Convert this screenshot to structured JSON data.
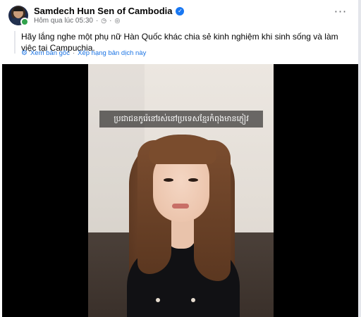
{
  "post": {
    "author_name": "Samdech Hun Sen of Cambodia",
    "timestamp": "Hôm qua lúc 05:30",
    "meta_separator": "·",
    "text": "Hãy lắng nghe một phụ nữ Hàn Quốc khác chia sẻ kinh nghiệm khi sinh sống và làm việc tại Campuchia.",
    "see_original_label": "Xem bản gốc",
    "translate_separator": "·",
    "rate_translation_label": "Xếp hạng bản dịch này"
  },
  "video": {
    "subtitle": "ប្រជាជនកូរ៉េនៅរស់នៅប្រទេសខ្មែរកំពុងមានភ្ញៀវ"
  },
  "icons": {
    "verified": "verified-badge-icon",
    "clock": "clock-icon",
    "globe": "globe-icon",
    "gear": "gear-icon",
    "more": "more-options-icon"
  },
  "colors": {
    "link": "#1b74e4",
    "verified": "#1877f2",
    "online": "#31a24c"
  }
}
